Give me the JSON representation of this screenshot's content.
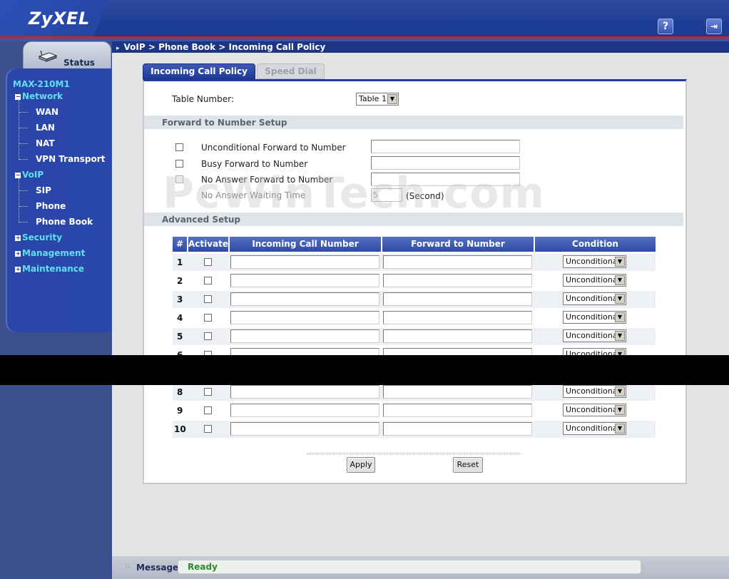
{
  "header": {
    "logo": "ZyXEL",
    "help_icon": "question-icon",
    "logout_icon": "logout-icon",
    "help_glyph": "?",
    "logout_glyph": "⇥"
  },
  "breadcrumb": "VoIP > Phone Book > Incoming Call Policy",
  "sidebar": {
    "status_tab": "Status",
    "device": "MAX-210M1",
    "network": "Network",
    "network_items": [
      "WAN",
      "LAN",
      "NAT",
      "VPN Transport"
    ],
    "voip": "VoIP",
    "voip_items": [
      "SIP",
      "Phone",
      "Phone Book"
    ],
    "security": "Security",
    "management": "Management",
    "maintenance": "Maintenance",
    "toggle_expanded": "−",
    "toggle_collapsed": "+"
  },
  "tabs": {
    "incoming": "Incoming Call Policy",
    "speed_dial": "Speed Dial"
  },
  "table_number": {
    "label": "Table Number:",
    "value": "Table 1"
  },
  "forward_setup": {
    "title": "Forward to Number Setup",
    "unconditional": "Unconditional Forward to Number",
    "busy": "Busy Forward to Number",
    "no_answer": "No Answer Forward to Number",
    "waiting_time_label": "No Answer Waiting Time",
    "waiting_time_value": "5",
    "waiting_time_unit": "(Second)"
  },
  "advanced": {
    "title": "Advanced Setup",
    "columns": [
      "#",
      "Activate",
      "Incoming Call Number",
      "Forward to Number",
      "Condition"
    ],
    "rows": [
      {
        "num": "1",
        "condition": "Unconditional"
      },
      {
        "num": "2",
        "condition": "Unconditional"
      },
      {
        "num": "3",
        "condition": "Unconditional"
      },
      {
        "num": "4",
        "condition": "Unconditional"
      },
      {
        "num": "5",
        "condition": "Unconditional"
      },
      {
        "num": "6",
        "condition": "Unconditional"
      },
      {
        "num": "8",
        "condition": "Unconditional"
      },
      {
        "num": "9",
        "condition": "Unconditional"
      },
      {
        "num": "10",
        "condition": "Unconditional"
      }
    ]
  },
  "buttons": {
    "apply": "Apply",
    "reset": "Reset"
  },
  "watermark": "PcWinTech.com",
  "footer": {
    "label": "Message",
    "status": "Ready"
  },
  "colors": {
    "accent": "#203c98",
    "nav_highlight": "#5fe0f2",
    "status_ok": "#2b8a2b"
  }
}
